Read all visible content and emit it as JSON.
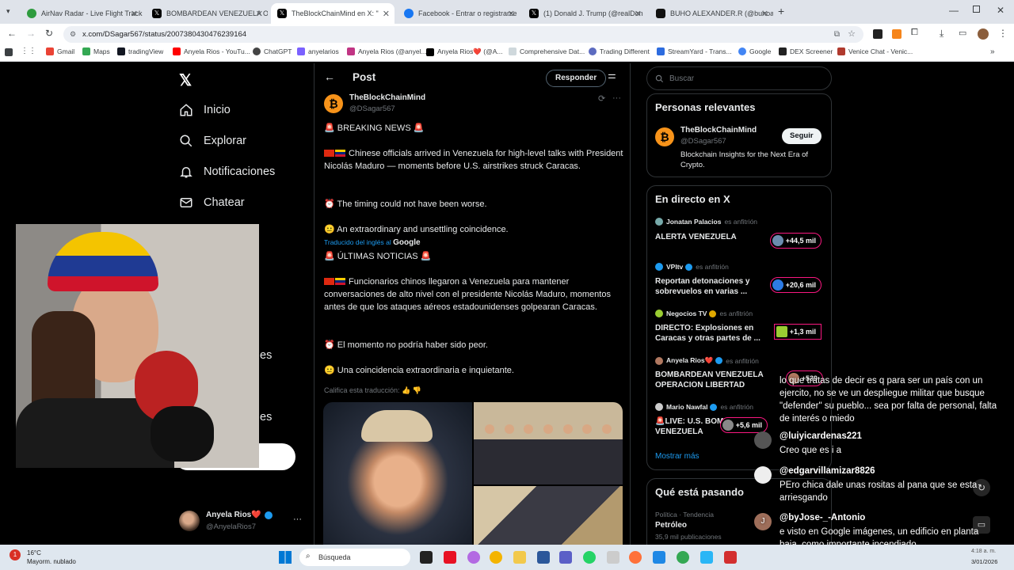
{
  "browser": {
    "tabs": [
      {
        "title": "AirNav Radar - Live Flight Track",
        "color": "#2e9b3e"
      },
      {
        "title": "BOMBARDEAN VENEZUELA OP",
        "color": "#000000"
      },
      {
        "title": "TheBlockChainMind en X: \"",
        "color": "#000000",
        "active": true
      },
      {
        "title": "Facebook - Entrar o registrarse",
        "color": "#1877f2"
      },
      {
        "title": "(1) Donald J. Trump (@realDon",
        "color": "#000000"
      },
      {
        "title": "BUHO ALEXANDER.R (@buhoa",
        "color": "#111111"
      }
    ],
    "url": "x.com/DSagar567/status/2007380430476239164",
    "bookmarks": [
      "Gmail",
      "Maps",
      "tradingView",
      "Anyela Rios - YouTu...",
      "ChatGPT",
      "anyelarios",
      "Anyela Rios (@anyel...",
      "Anyela Rios❤️ (@A...",
      "Comprehensive Dat...",
      "Trading Different",
      "StreamYard - Trans...",
      "Google",
      "DEX Screener",
      "Venice Chat - Venic..."
    ]
  },
  "sidebar": {
    "items": [
      {
        "label": "Inicio",
        "icon": "home-icon"
      },
      {
        "label": "Explorar",
        "icon": "search-icon"
      },
      {
        "label": "Notificaciones",
        "icon": "bell-icon"
      },
      {
        "label": "Chatear",
        "icon": "mail-icon"
      }
    ],
    "partial_1": "es",
    "partial_2": "es",
    "account_name": "Anyela Rios❤️",
    "account_handle": "@AnyelaRios7",
    "more": "···"
  },
  "post": {
    "header_title": "Post",
    "reply_button": "Responder",
    "author_name": "TheBlockChainMind",
    "author_handle": "@DSagar567",
    "more": "···",
    "lines": {
      "l1": "🚨 BREAKING NEWS 🚨",
      "l2": "Chinese officials arrived in Venezuela for high-level talks with President Nicolás Maduro — moments before U.S. airstrikes struck Caracas.",
      "l3": "⏰ The timing could not have been worse.",
      "l4": "😐 An extraordinary and unsettling coincidence.",
      "translated_prefix": "Traducido del inglés al",
      "translated_brand": "Google",
      "l5": "🚨 ÚLTIMAS NOTICIAS 🚨",
      "l6": "Funcionarios chinos llegaron a Venezuela para mantener conversaciones de alto nivel con el presidente Nicolás Maduro, momentos antes de que los ataques aéreos estadounidenses golpearan Caracas.",
      "l7": "⏰ El momento no podría haber sido peor.",
      "l8": "😐 Una coincidencia extraordinaria e inquietante.",
      "rate": "Califica esta traducción:"
    }
  },
  "right": {
    "search_placeholder": "Buscar",
    "relevant_title": "Personas relevantes",
    "rel_name": "TheBlockChainMind",
    "rel_handle": "@DSagar567",
    "rel_bio": "Blockchain Insights for the Next Era of Crypto.",
    "follow": "Seguir",
    "live_title": "En directo en X",
    "live": [
      {
        "host": "Jonatan Palacios",
        "sub": "es anfitrión",
        "title": "ALERTA VENEZUELA",
        "count": "+44,5 mil"
      },
      {
        "host": "VPItv",
        "sub": "es anfitrión",
        "title": "Reportan detonaciones y sobrevuelos en varias ...",
        "count": "+20,6 mil"
      },
      {
        "host": "Negocios TV",
        "sub": "es anfitrión",
        "title": "DIRECTO: Explosiones en Caracas y otras partes de ...",
        "count": "+1,3 mil"
      },
      {
        "host": "Anyela Rios❤️",
        "sub": "es anfitrión",
        "title": "BOMBARDEAN VENEZUELA OPERACION LIBERTAD",
        "count": "+539"
      },
      {
        "host": "Mario Nawfal",
        "sub": "es anfitrión",
        "title": "🚨LIVE: U.S. BOMBING VENEZUELA",
        "count": "+5,6 mil"
      }
    ],
    "show_more": "Mostrar más",
    "trending_title": "Qué está pasando",
    "trend_meta": "Política · Tendencia",
    "trend_name": "Petróleo",
    "trend_count": "35,9 mil publicaciones"
  },
  "chat": [
    {
      "name": "",
      "msg": "lo que tratas de decir es q para ser un país con un ejercito, no se ve un despliegue militar que busque \"defender\" su pueblo... sea por falta de personal, falta de interés o miedo"
    },
    {
      "name": "@luiyicardenas221",
      "msg": "Creo que es i a"
    },
    {
      "name": "@edgarvillamizar8826",
      "msg": "PEro chica dale unas rositas al pana que se esta arriesgando"
    },
    {
      "name": "@byJose-_-Antonio",
      "msg": "e visto en Google imágenes, un edificio en planta baja, como importante incendiado.",
      "initial": "J"
    }
  ],
  "taskbar": {
    "weather_temp": "16°C",
    "weather_desc": "Mayorm. nublado",
    "search": "Búsqueda",
    "date": "3/01/2026",
    "time": "4:18 a. m."
  }
}
